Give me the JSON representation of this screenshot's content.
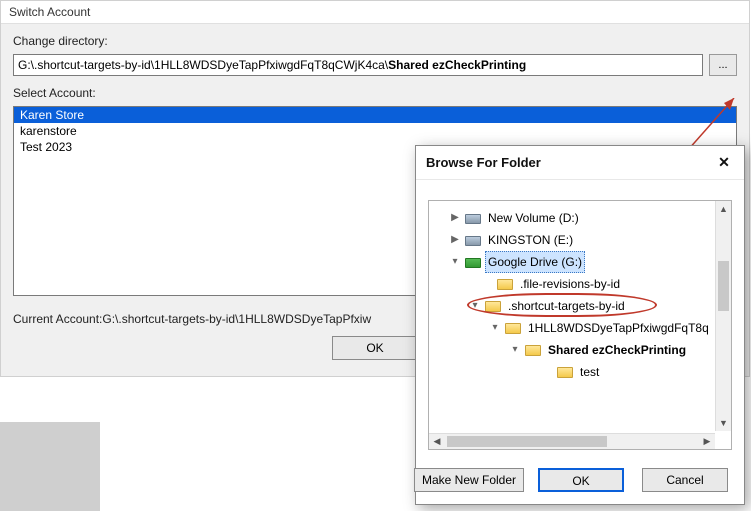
{
  "window": {
    "title": "Switch Account",
    "change_dir_label": "Change directory:",
    "path_prefix": "G:\\.shortcut-targets-by-id\\1HLL8WDSDyeTapPfxiwgdFqT8qCWjK4ca\\",
    "path_bold": "Shared ezCheckPrinting",
    "browse_button_label": "...",
    "select_account_label": "Select Account:",
    "accounts": [
      "Karen Store",
      "karenstore",
      "Test 2023"
    ],
    "current_account_label": "Current Account:G:\\.shortcut-targets-by-id\\1HLL8WDSDyeTapPfxiw",
    "ok_label": "OK"
  },
  "dialog": {
    "title": "Browse For Folder",
    "close_label": "✕",
    "make_new_folder_label": "Make New Folder",
    "ok_label": "OK",
    "cancel_label": "Cancel",
    "tree": {
      "new_volume": "New Volume (D:)",
      "kingston": "KINGSTON (E:)",
      "gdrive": "Google Drive (G:)",
      "file_revisions": ".file-revisions-by-id",
      "shortcut_targets": ".shortcut-targets-by-id",
      "hash_folder": "1HLL8WDSDyeTapPfxiwgdFqT8q",
      "shared_folder": "Shared ezCheckPrinting",
      "test_folder": "test"
    }
  }
}
